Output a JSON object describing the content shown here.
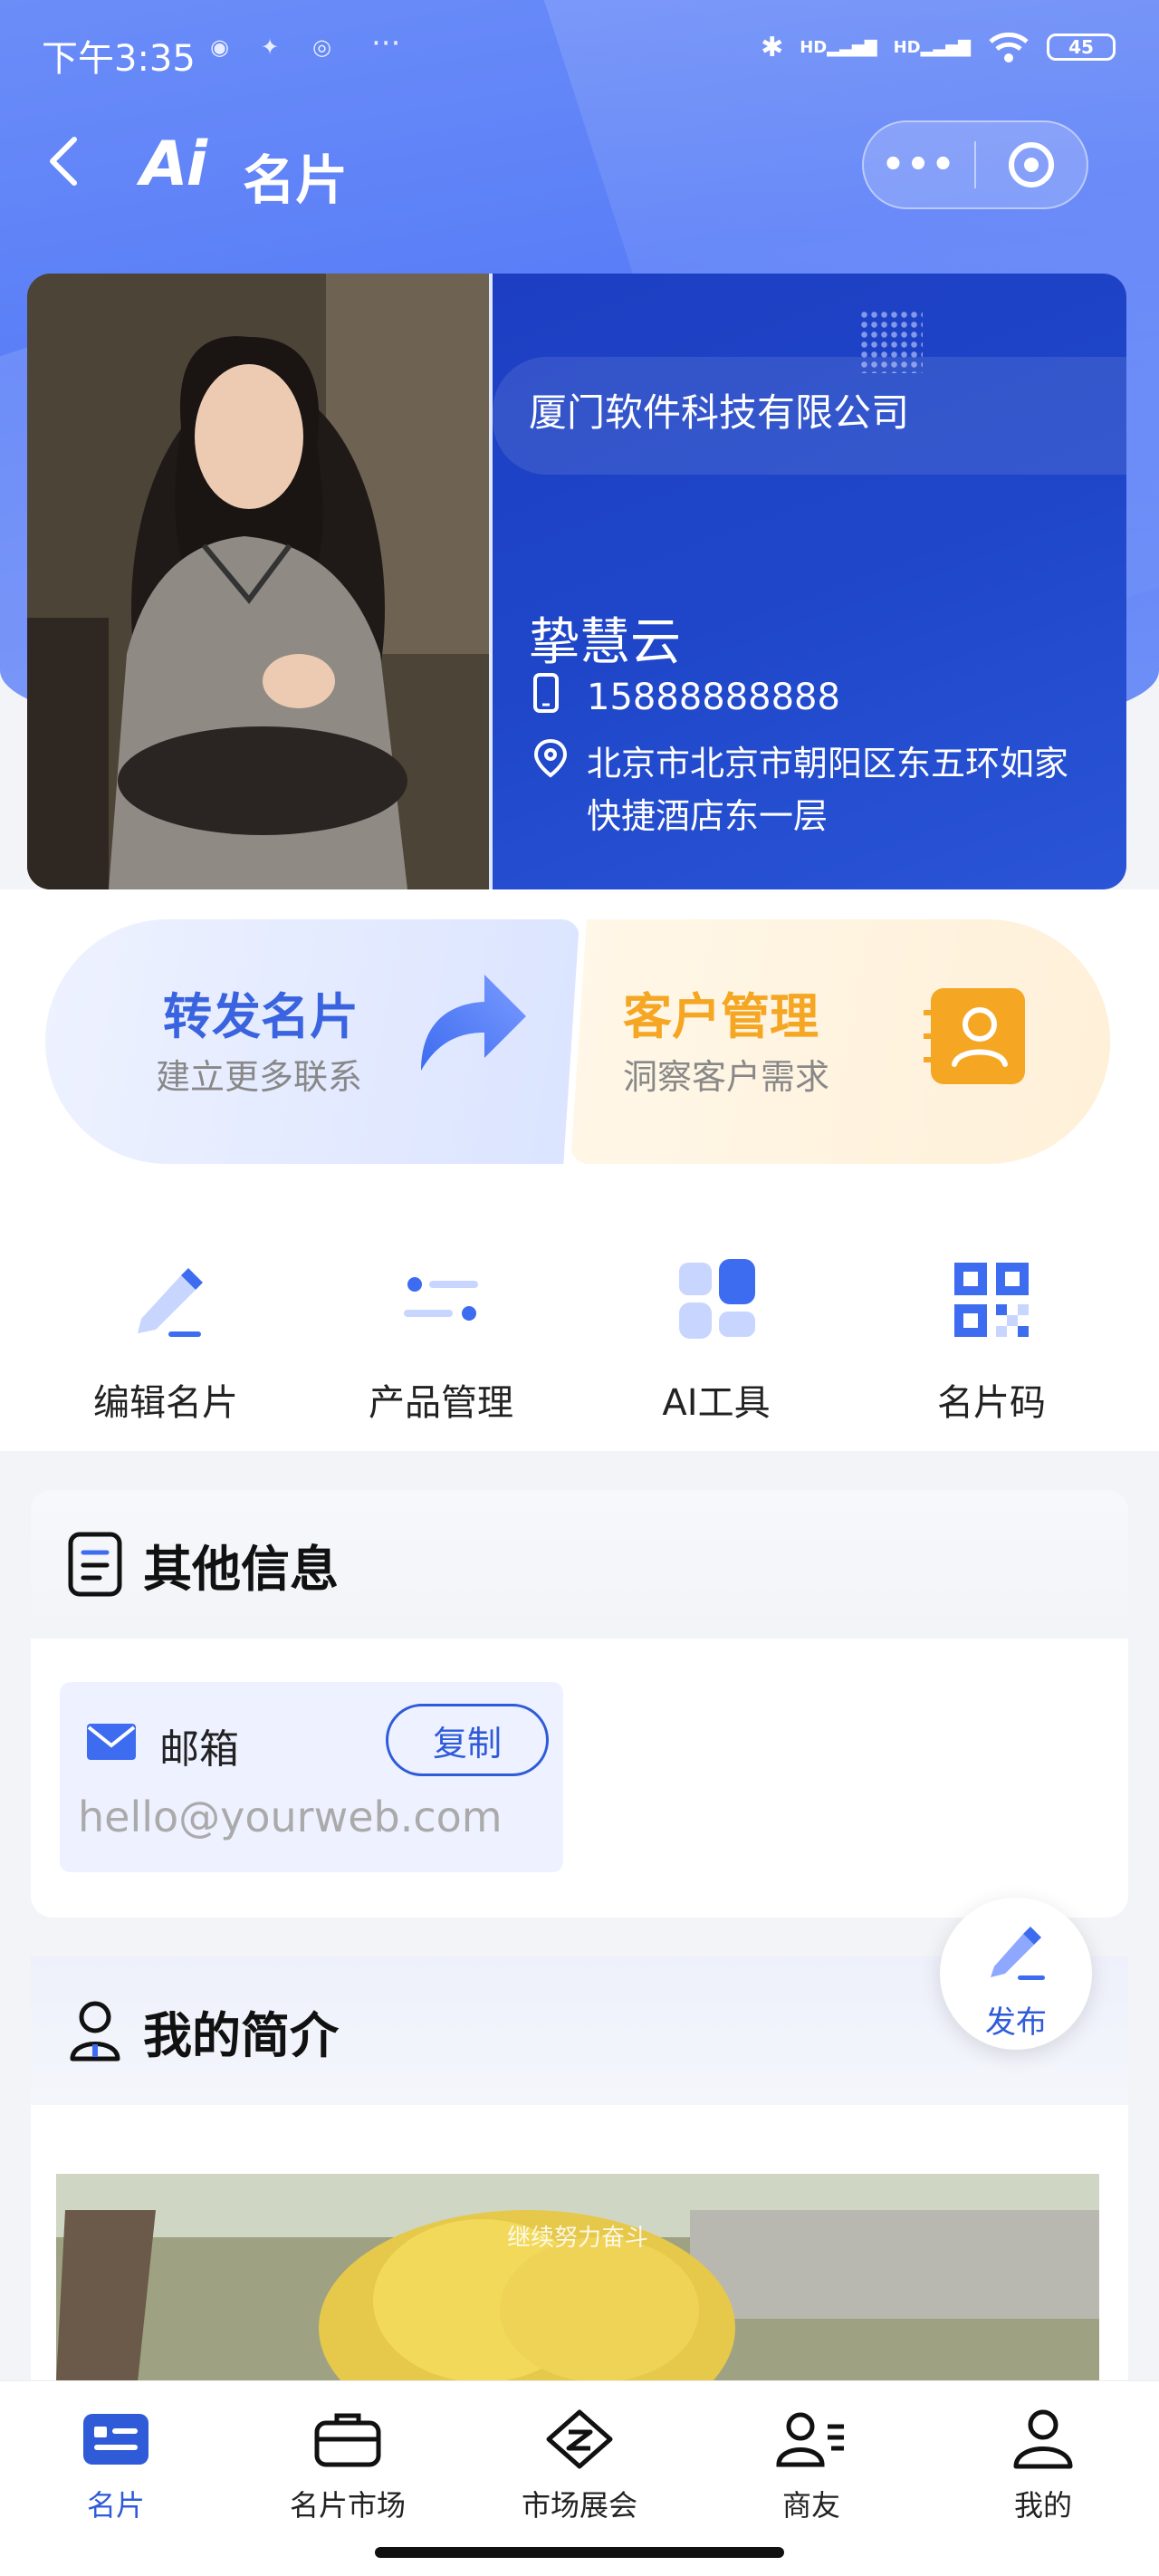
{
  "status": {
    "time": "下午3:35",
    "more": "···",
    "hd1": "HD",
    "hd2": "HD",
    "battery": "45"
  },
  "nav": {
    "logo": "Ai",
    "title": "名片",
    "more_label": "•••"
  },
  "card": {
    "company": "厦门软件科技有限公司",
    "name": "挚慧云",
    "phone": "15888888888",
    "address": "北京市北京市朝阳区东五环如家快捷酒店东一层"
  },
  "features": {
    "forward": {
      "title": "转发名片",
      "subtitle": "建立更多联系"
    },
    "customer": {
      "title": "客户管理",
      "subtitle": "洞察客户需求"
    }
  },
  "quick_actions": [
    {
      "label": "编辑名片",
      "icon": "edit-icon"
    },
    {
      "label": "产品管理",
      "icon": "product-list-icon"
    },
    {
      "label": "AI工具",
      "icon": "ai-tools-icon"
    },
    {
      "label": "名片码",
      "icon": "qr-code-icon"
    }
  ],
  "other_info": {
    "title": "其他信息",
    "email_label": "邮箱",
    "copy_label": "复制",
    "email_value": "hello@yourweb.com"
  },
  "publish": {
    "label": "发布"
  },
  "intro": {
    "title": "我的简介",
    "image_caption": "继续努力奋斗"
  },
  "tabbar": [
    {
      "label": "名片",
      "icon": "card-icon",
      "active": true
    },
    {
      "label": "名片市场",
      "icon": "briefcase-icon",
      "active": false
    },
    {
      "label": "市场展会",
      "icon": "exhibition-icon",
      "active": false
    },
    {
      "label": "商友",
      "icon": "contacts-icon",
      "active": false
    },
    {
      "label": "我的",
      "icon": "profile-icon",
      "active": false
    }
  ],
  "colors": {
    "primary": "#2f5bd9",
    "accent_orange": "#f5a623",
    "card_blue": "#1f46c9"
  }
}
